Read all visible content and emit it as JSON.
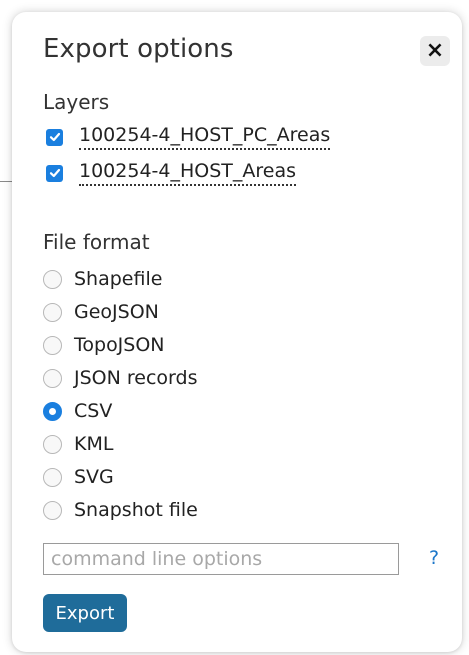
{
  "dialog": {
    "title": "Export options",
    "close_label": "×"
  },
  "layers": {
    "label": "Layers",
    "items": [
      {
        "name": "100254-4_HOST_PC_Areas",
        "checked": true
      },
      {
        "name": "100254-4_HOST_Areas",
        "checked": true
      }
    ]
  },
  "file_format": {
    "label": "File format",
    "options": [
      {
        "label": "Shapefile",
        "selected": false
      },
      {
        "label": "GeoJSON",
        "selected": false
      },
      {
        "label": "TopoJSON",
        "selected": false
      },
      {
        "label": "JSON records",
        "selected": false
      },
      {
        "label": "CSV",
        "selected": true
      },
      {
        "label": "KML",
        "selected": false
      },
      {
        "label": "SVG",
        "selected": false
      },
      {
        "label": "Snapshot file",
        "selected": false
      }
    ]
  },
  "command": {
    "placeholder": "command line options",
    "value": "",
    "help_label": "?"
  },
  "export_button": {
    "label": "Export"
  },
  "colors": {
    "accent": "#1a7fdf",
    "button": "#1f6c9a",
    "help_link": "#1b76c9"
  }
}
